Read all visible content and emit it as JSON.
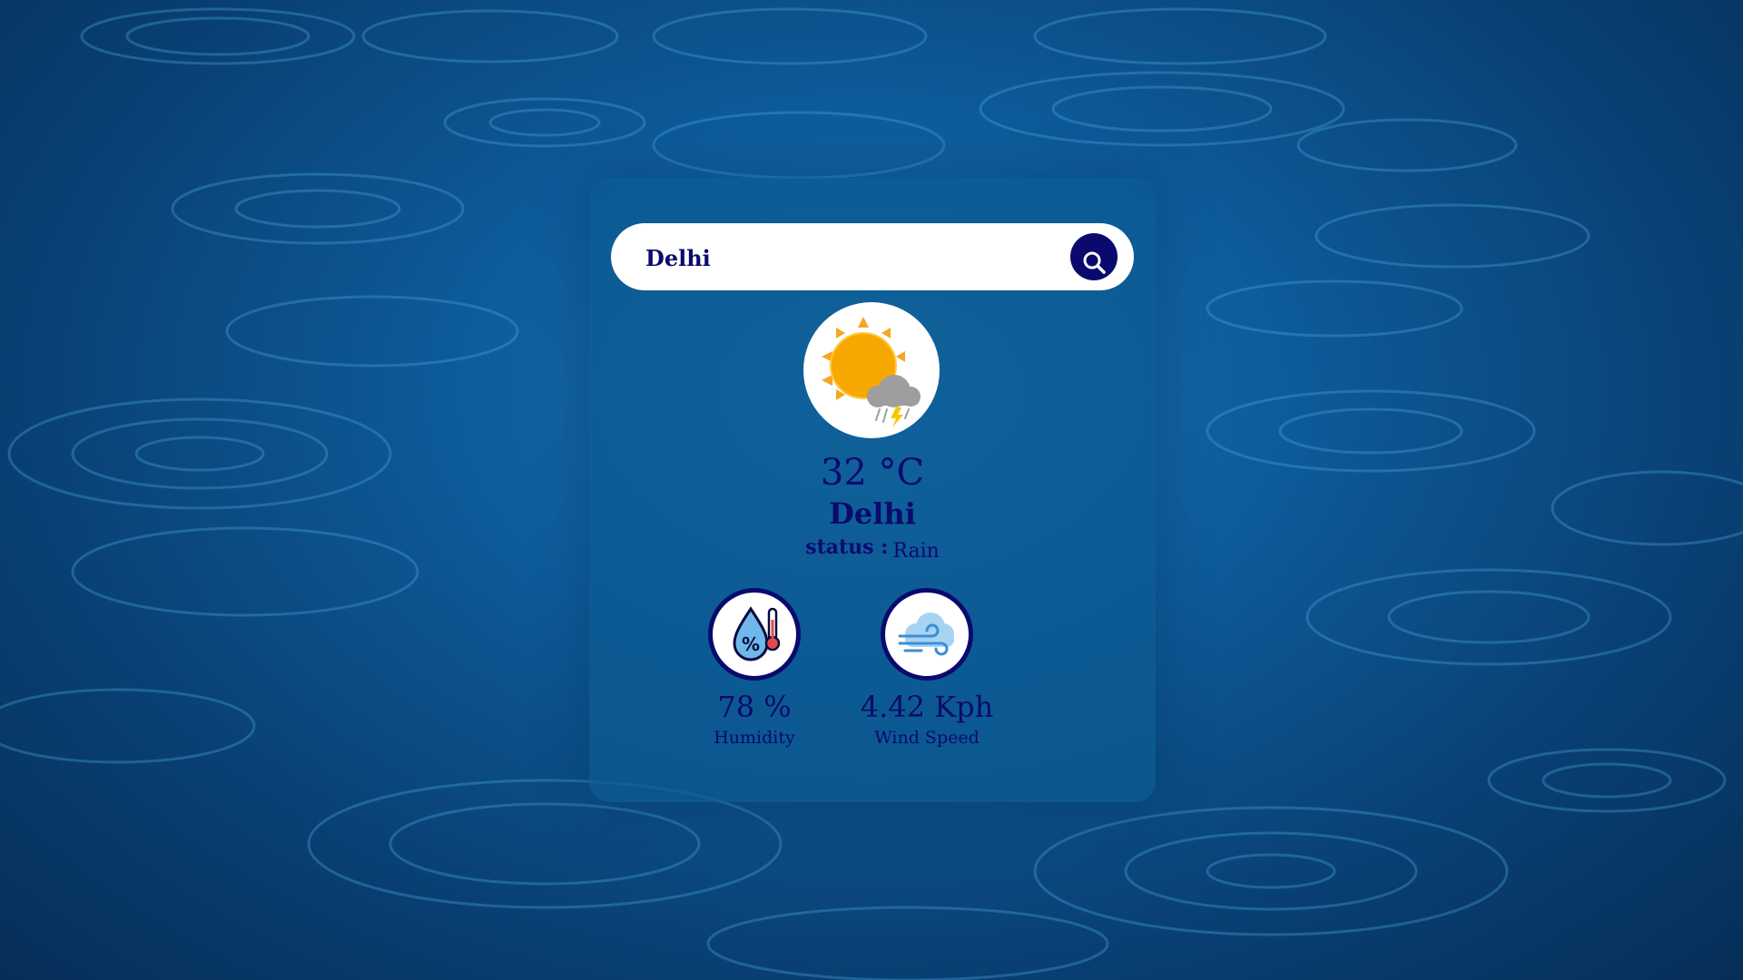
{
  "search": {
    "value": "Delhi",
    "button_icon": "search-icon"
  },
  "weather": {
    "icon": "sun-cloud-thunder-icon",
    "temperature": "32 °C",
    "city": "Delhi",
    "status_label": "status :",
    "status_value": "Rain"
  },
  "metrics": {
    "humidity": {
      "icon": "humidity-icon",
      "value": "78 %",
      "label": "Humidity"
    },
    "wind": {
      "icon": "wind-icon",
      "value": "4.42 Kph",
      "label": "Wind Speed"
    }
  },
  "colors": {
    "accent": "#0a0a6e",
    "card_bg": "#0c5a92",
    "background": "#0d5a98"
  }
}
